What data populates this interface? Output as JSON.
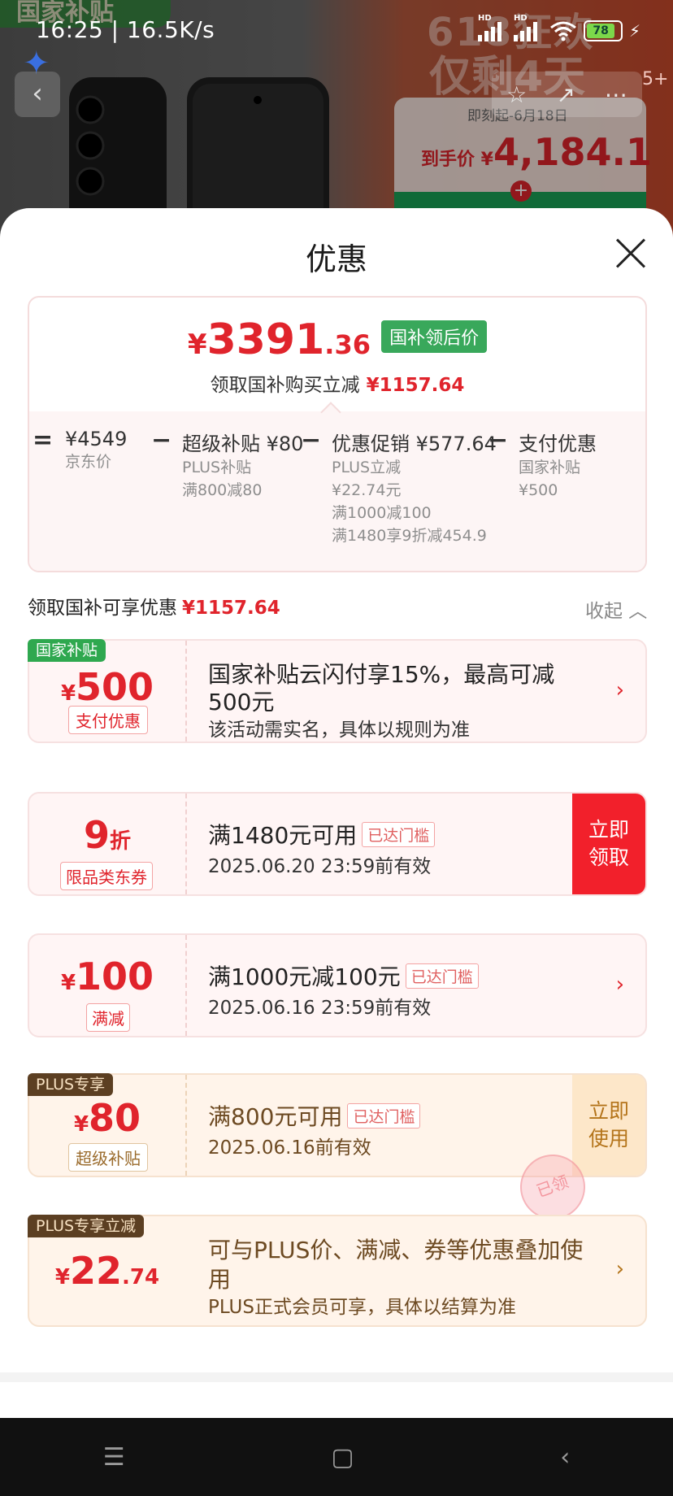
{
  "status": {
    "time": "16:25 | 16.5K/s",
    "battery": "78",
    "signal_label": "HD"
  },
  "hero": {
    "tag": "国家补贴",
    "promo_top": "618狂欢",
    "promo_mid": "仅剩4天",
    "promo_date": "即刻起-6月18日",
    "promo_price_label": "到手价 ¥",
    "promo_price": "4,184.1",
    "more_badge": "5+"
  },
  "sheet": {
    "title": "优惠",
    "final_price": {
      "yen": "¥",
      "int": "3391",
      "dec": ".36",
      "tag": "国补领后价"
    },
    "saved": {
      "label": "领取国补购买立减",
      "amount": "¥1157.64"
    },
    "breakdown": [
      {
        "op": "=",
        "title": "¥4549",
        "lines": [
          "京东价"
        ]
      },
      {
        "op": "−",
        "title": "超级补贴 ¥80",
        "lines": [
          "PLUS补贴",
          "满800减80"
        ]
      },
      {
        "op": "−",
        "title": "优惠促销 ¥577.64",
        "lines": [
          "PLUS立减",
          "¥22.74元",
          "满1000减100",
          "满1480享9折减454.9"
        ]
      },
      {
        "op": "−",
        "title": "支付优惠",
        "lines": [
          "国家补贴",
          "¥500"
        ]
      }
    ],
    "section": {
      "label": "领取国补可享优惠",
      "amount": "¥1157.64",
      "collapse": "收起"
    },
    "cards": [
      {
        "corner": "国家补贴",
        "yen": "¥",
        "num": "500",
        "small": "",
        "tag": "支付优惠",
        "main": "国家补贴云闪付享15%，最高可减",
        "main2": "500元",
        "sub": "该活动需实名，具体以规则为准",
        "action": "›"
      },
      {
        "corner": "",
        "yen": "",
        "num": "9",
        "small": "折",
        "tag": "限品类东券",
        "main": "满1480元可用",
        "reached": "已达门槛",
        "sub": "2025.06.20 23:59前有效",
        "action": "立即\n领取"
      },
      {
        "corner": "",
        "yen": "¥",
        "num": "100",
        "small": "",
        "tag": "满减",
        "main": "满1000元减100元",
        "reached": "已达门槛",
        "sub": "2025.06.16 23:59前有效",
        "action": "›"
      },
      {
        "corner": "PLUS专享",
        "yen": "¥",
        "num": "80",
        "small": "",
        "tag": "超级补贴",
        "main": "满800元可用",
        "reached": "已达门槛",
        "sub": "2025.06.16前有效",
        "action": "立即\n使用",
        "stamp": "已领"
      },
      {
        "corner": "PLUS专享立减",
        "yen": "¥",
        "num": "22",
        "small": ".74",
        "tag": "",
        "main": "可与PLUS价、满减、券等优惠叠加使",
        "main2": "用",
        "sub": "PLUS正式会员可享，具体以结算为准",
        "action": "›"
      }
    ]
  },
  "navbar": {
    "menu": "☰",
    "home": "▢",
    "back": "‹"
  },
  "colors": {
    "accent_red": "#e0242c",
    "green_tag": "#39a85b",
    "plus_dark": "#5c3f22"
  }
}
